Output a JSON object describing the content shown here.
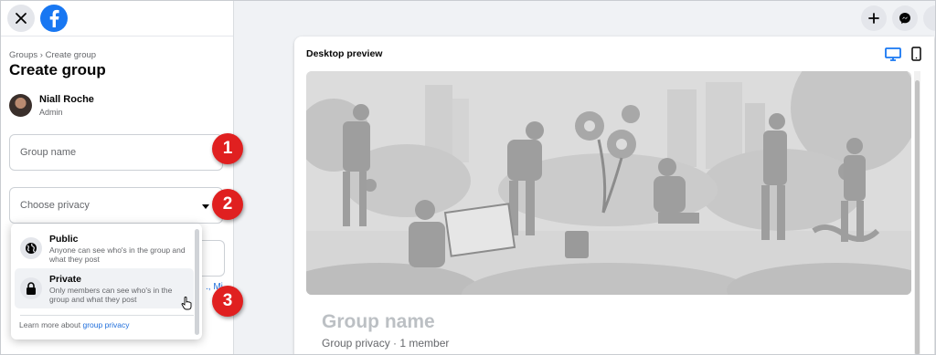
{
  "breadcrumb": "Groups › Create group",
  "page_title": "Create group",
  "user": {
    "name": "Niall Roche",
    "role": "Admin"
  },
  "fields": {
    "group_name_placeholder": "Group name",
    "privacy_placeholder": "Choose privacy"
  },
  "partial_link": "., Mi",
  "privacy_menu": {
    "options": [
      {
        "title": "Public",
        "description": "Anyone can see who's in the group and what they post",
        "icon": "globe-icon"
      },
      {
        "title": "Private",
        "description": "Only members can see who's in the group and what they post",
        "icon": "lock-icon"
      }
    ],
    "learn_more_prefix": "Learn more about ",
    "learn_more_link": "group privacy"
  },
  "badges": [
    "1",
    "2",
    "3"
  ],
  "preview": {
    "label": "Desktop preview",
    "group_name": "Group name",
    "group_meta": "Group privacy · 1 member"
  },
  "colors": {
    "brand": "#1877f2",
    "badge": "#e02020",
    "link": "#216fdb"
  }
}
